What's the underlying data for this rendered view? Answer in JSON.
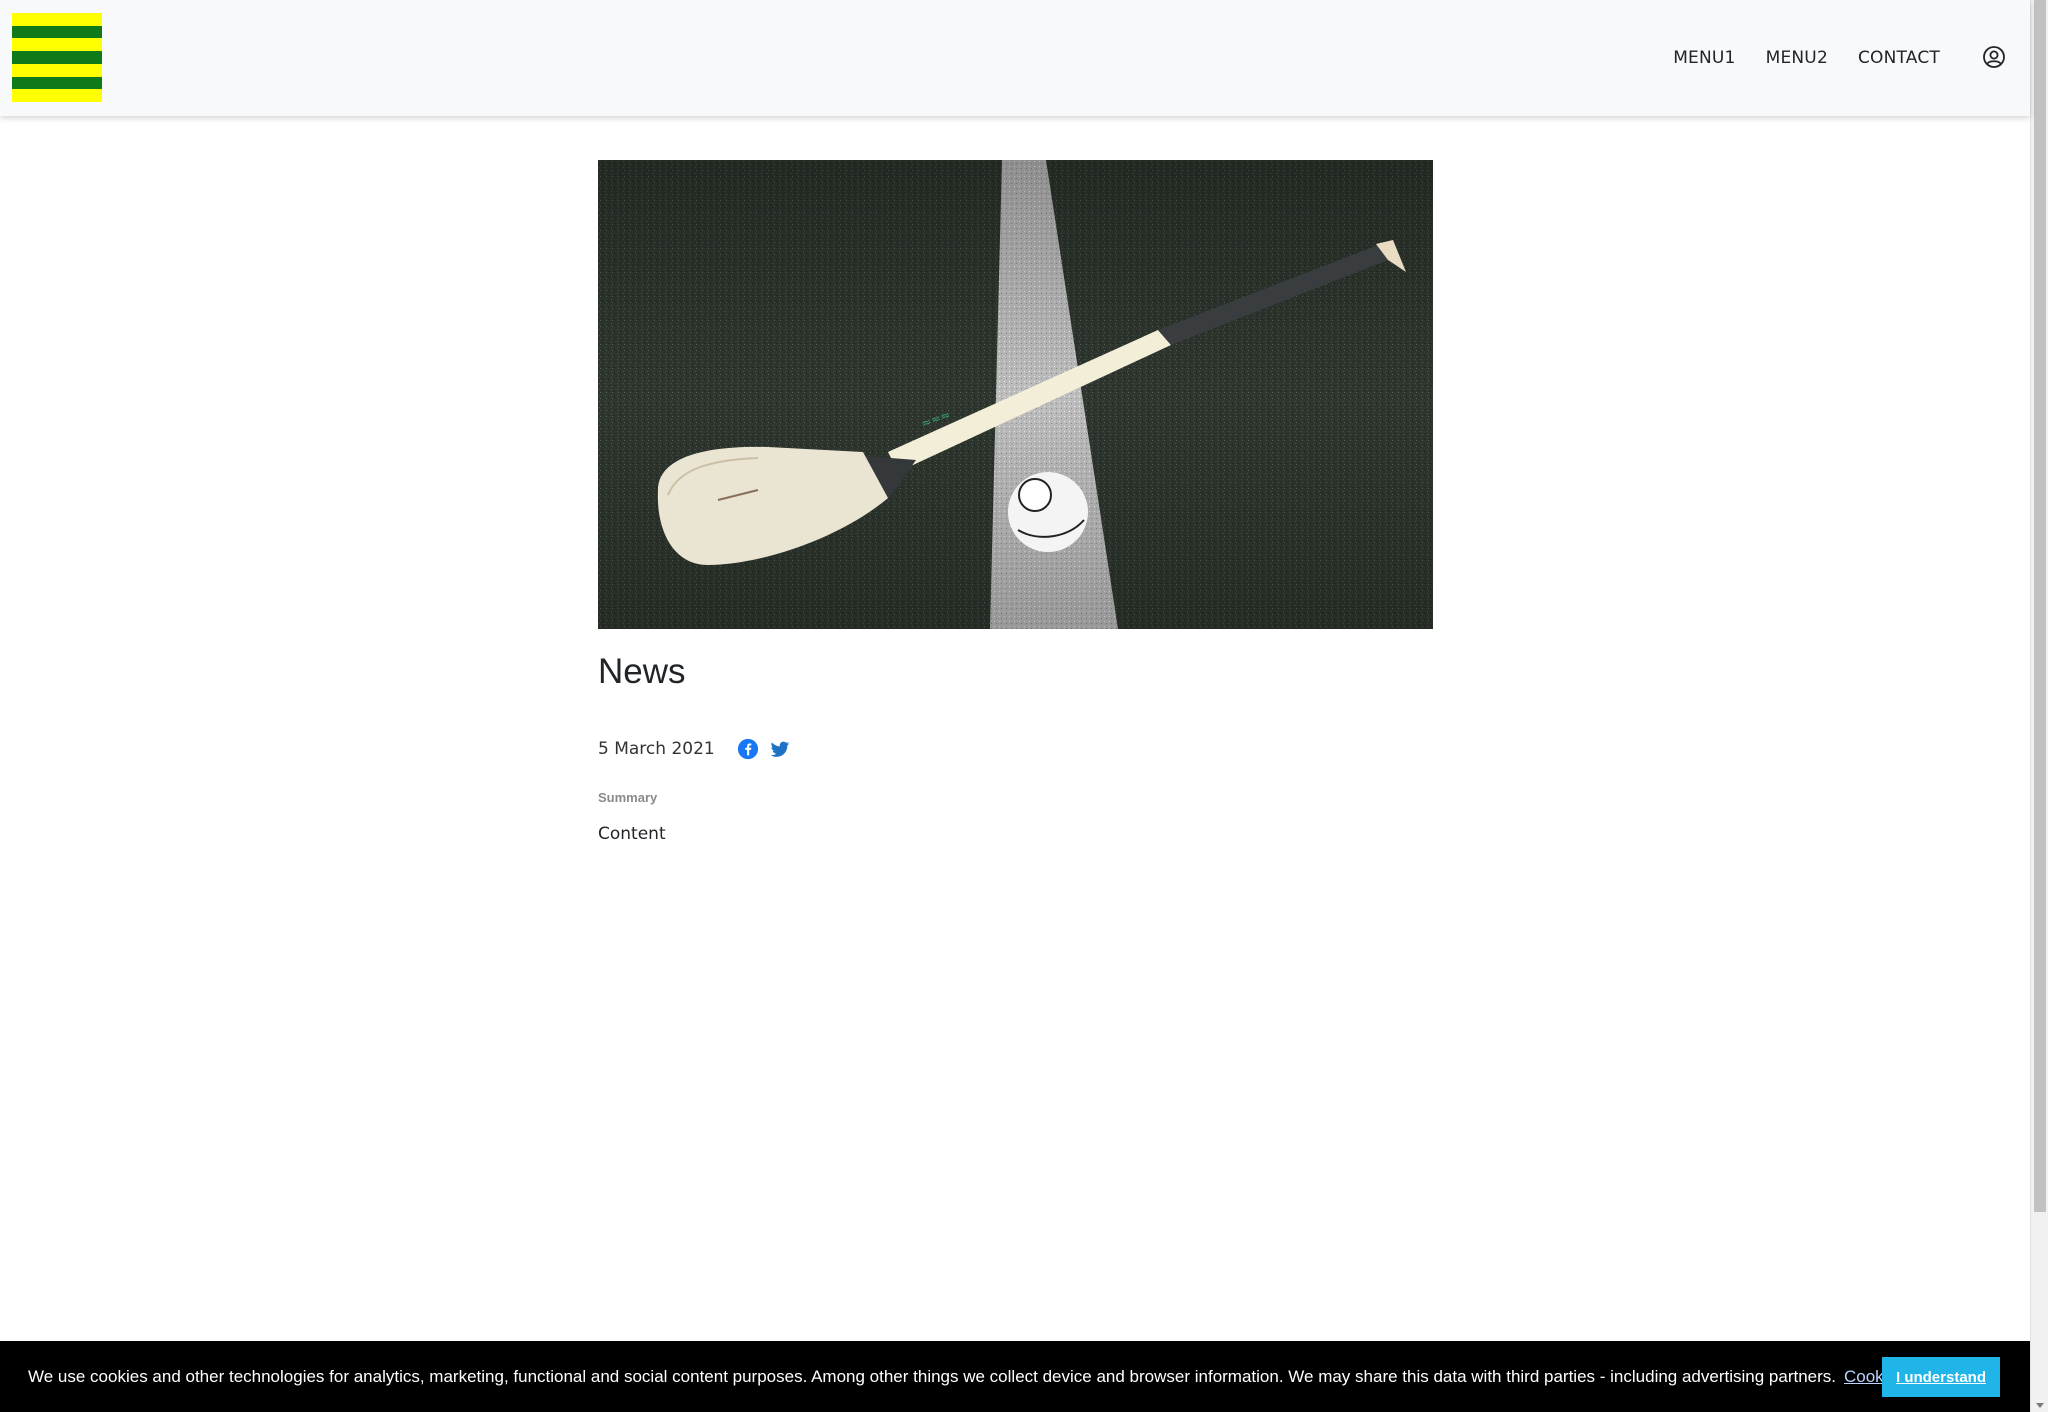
{
  "header": {
    "logo_colors": [
      "#0f7a1a",
      "#ffff00",
      "#0f7a1a",
      "#ffff00",
      "#0f7a1a",
      "#ffff00",
      "#0f7a1a"
    ],
    "nav": [
      {
        "label": "MENU1"
      },
      {
        "label": "MENU2"
      },
      {
        "label": "CONTACT"
      }
    ],
    "user_icon": "user-circle-icon"
  },
  "article": {
    "image_description_icon": "hurley-and-sliotar-photo",
    "title": "News",
    "date": "5 March 2021",
    "share_icons": [
      "facebook-icon",
      "twitter-icon"
    ],
    "summary_label": "Summary",
    "content": "Content"
  },
  "cookie_bar": {
    "message": "We use cookies and other technologies for analytics, marketing, functional and social content purposes. Among other things we collect device and browser information. We may share this data with third parties - including advertising partners.",
    "policy_link": "Cookies Policy",
    "accept_button": "I understand"
  },
  "colors": {
    "accent_blue": "#1877f2",
    "cookie_button": "#1fb5e8"
  }
}
